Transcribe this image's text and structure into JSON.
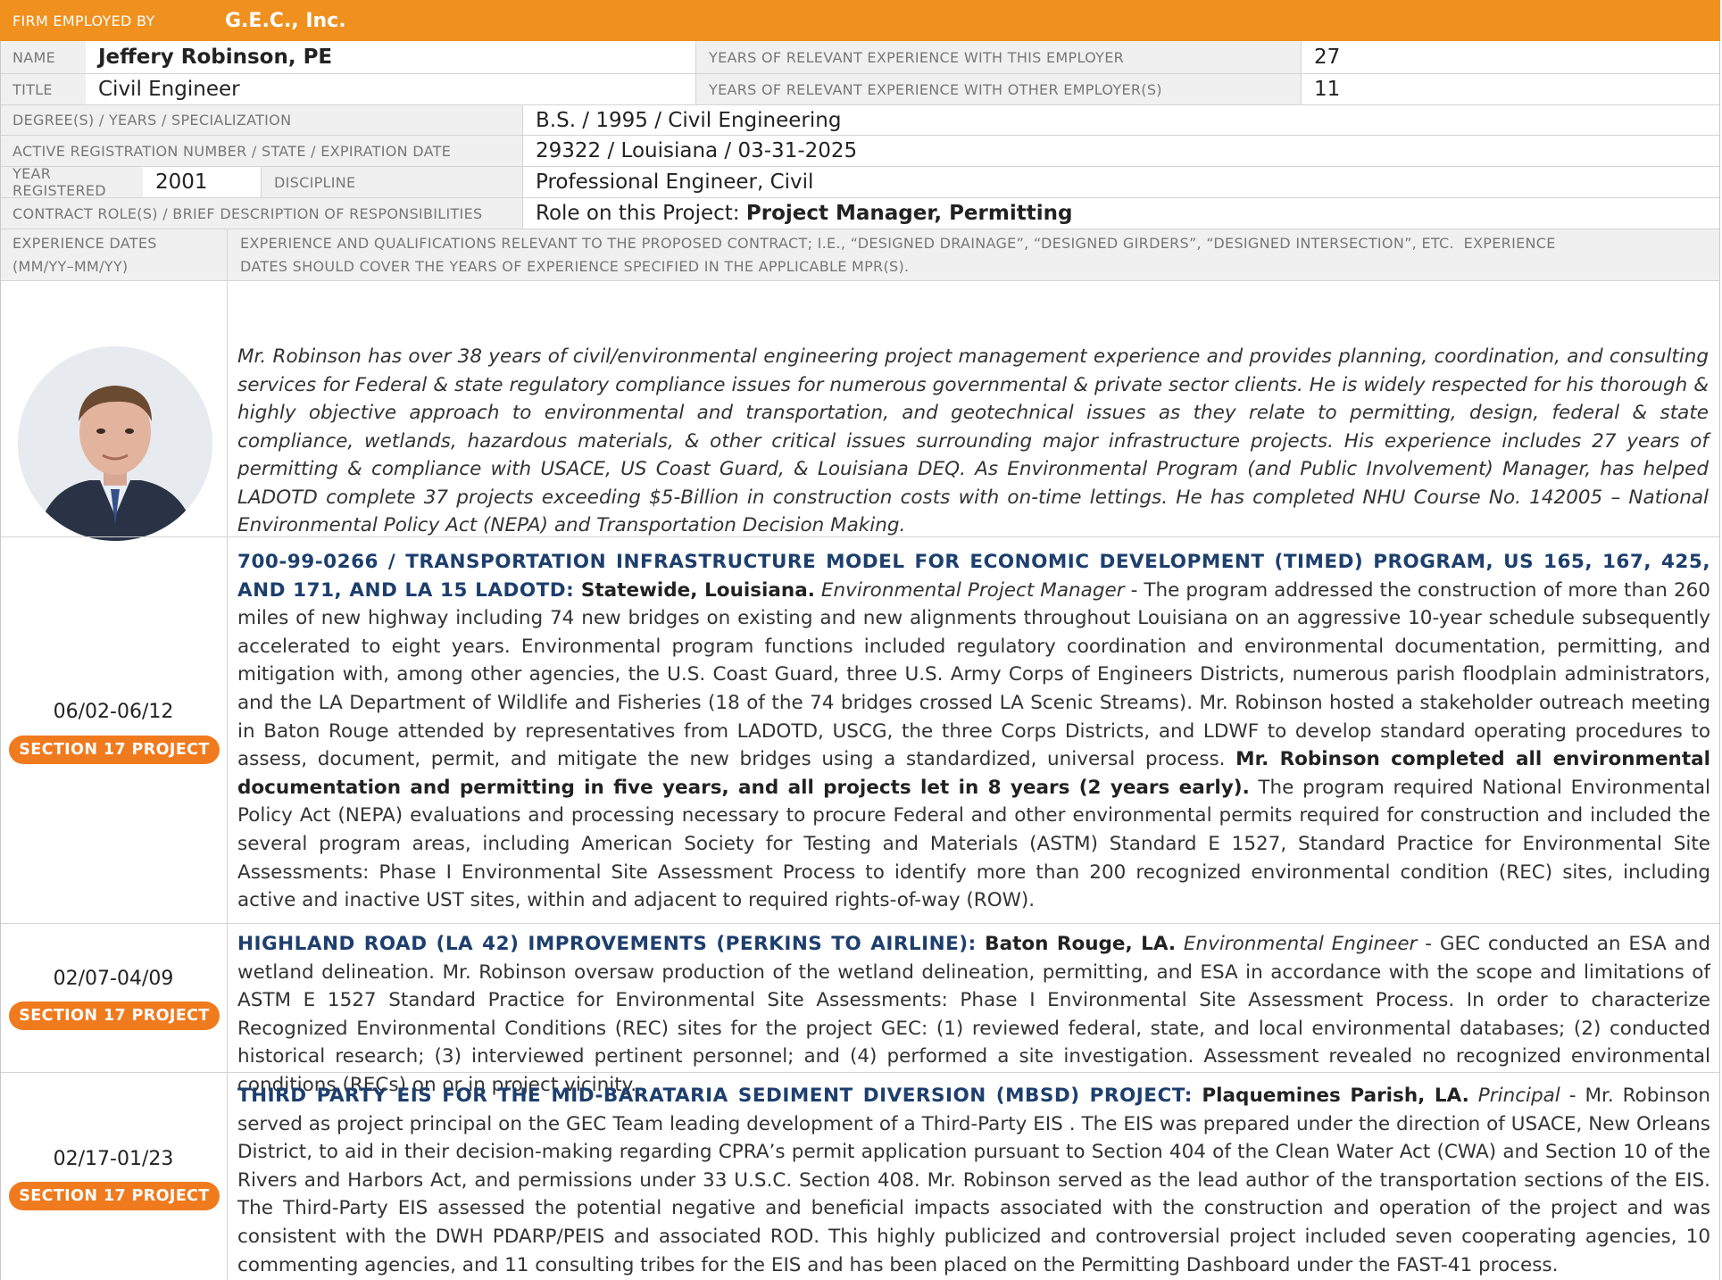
{
  "firm": {
    "label": "FIRM EMPLOYED BY",
    "name": "G.E.C., Inc."
  },
  "person": {
    "name_label": "NAME",
    "name": "Jeffery Robinson, PE",
    "title_label": "TITLE",
    "title": "Civil Engineer",
    "years_employer_label": "YEARS OF RELEVANT EXPERIENCE WITH THIS EMPLOYER",
    "years_employer": "27",
    "years_other_label": "YEARS OF RELEVANT EXPERIENCE WITH OTHER EMPLOYER(S)",
    "years_other": "11",
    "degree_label": "DEGREE(S) / YEARS / SPECIALIZATION",
    "degree": "B.S. / 1995 / Civil Engineering",
    "registration_label": "ACTIVE REGISTRATION NUMBER / STATE / EXPIRATION DATE",
    "registration": "29322 / Louisiana / 03-31-2025",
    "year_registered_label": "YEAR REGISTERED",
    "year_registered": "2001",
    "discipline_label": "DISCIPLINE",
    "discipline": "Professional Engineer, Civil",
    "contract_role_label": "CONTRACT ROLE(S) / BRIEF DESCRIPTION OF RESPONSIBILITIES",
    "role_prefix": "Role on this Project: ",
    "role": "Project Manager, Permitting"
  },
  "experience_header": {
    "dates_label_1": "EXPERIENCE DATES",
    "dates_label_2": "(MM/YY–MM/YY)",
    "qual_label_1": "EXPERIENCE AND QUALIFICATIONS RELEVANT TO THE PROPOSED CONTRACT; I.E., “DESIGNED DRAINAGE”, “DESIGNED GIRDERS”, “DESIGNED INTERSECTION”, ETC.  EXPERIENCE",
    "qual_label_2": "DATES SHOULD COVER THE YEARS OF EXPERIENCE SPECIFIED IN THE APPLICABLE MPR(S)."
  },
  "bio": "Mr. Robinson has over 38 years of civil/environmental engineering project management experience and provides planning, coordination, and consulting services for Federal & state regulatory compliance issues for numerous governmental & private sector clients. He is widely respected for his thorough & highly objective approach to environmental and transportation, and geotechnical issues as they relate to permitting, design, federal & state compliance, wetlands, hazardous materials, & other critical issues surrounding major infrastructure projects. His experience includes 27 years of permitting & compliance with USACE, US Coast Guard, & Louisiana DEQ. As Environmental Program (and Public Involvement) Manager, has helped LADOTD complete 37 projects exceeding $5-Billion in construction costs with on-time lettings. He has completed NHU Course No. 142005 – National Environmental Policy Act (NEPA) and Transportation Decision Making.",
  "badge_label": "SECTION 17 PROJECT",
  "projects": [
    {
      "dates": "06/02-06/12",
      "title": "700-99-0266 / TRANSPORTATION INFRASTRUCTURE MODEL FOR ECONOMIC DEVELOPMENT (TIMED) PROGRAM, US 165, 167, 425, AND 171, AND LA 15 LADOTD:",
      "location": " Statewide, Louisiana.",
      "role": " Environmental Project Manager",
      "desc_1": " - The program addressed the construction of more than 260 miles of new highway including 74 new bridges on existing and new alignments throughout Louisiana on an aggressive 10-year schedule subsequently accelerated to eight years. Environmental program functions included regulatory coordination and environmental documentation, permitting, and mitigation with, among other agencies, the U.S. Coast Guard, three U.S. Army Corps of Engineers Districts, numerous parish floodplain administrators, and the LA Department of Wildlife and Fisheries (18 of the 74 bridges crossed LA Scenic Streams). Mr. Robinson hosted a stakeholder outreach meeting in Baton Rouge attended by representatives from LADOTD, USCG, the three Corps Districts, and LDWF to develop standard operating procedures to assess, document, permit, and mitigate the new bridges using a standardized, universal process. ",
      "highlight": "Mr. Robinson completed all environmental documentation and permitting in five years, and all projects let in 8 years (2 years early).",
      "desc_2": " The program required National Environmental Policy Act (NEPA) evaluations and processing necessary to procure Federal and other environmental permits required for construction and included the several program areas, including American Society for Testing and Materials (ASTM) Standard E 1527, Standard Practice for Environmental Site Assessments:  Phase I Environmental Site Assessment Process to identify more than 200 recognized environmental condition (REC) sites, including active and inactive UST sites, within and adjacent to required rights-of-way (ROW)."
    },
    {
      "dates": "02/07-04/09",
      "title": "HIGHLAND ROAD (LA 42) IMPROVEMENTS (PERKINS TO AIRLINE):",
      "location": " Baton Rouge, LA.",
      "role": " Environmental Engineer",
      "desc_1": " - GEC conducted an ESA and wetland delineation. Mr. Robinson oversaw production of the wetland delineation, permitting, and ESA in accordance with the scope and limitations of ASTM E 1527 Standard Practice for Environmental Site Assessments: Phase I Environmental Site Assessment Process. In order to characterize Recognized Environmental Conditions (REC) sites for the project GEC: (1) reviewed federal, state, and local environmental databases; (2) conducted historical research; (3) interviewed pertinent personnel; and (4) performed a site investigation. Assessment revealed no recognized environmental conditions (RECs) on or in project vicinity.",
      "highlight": "",
      "desc_2": ""
    },
    {
      "dates": "02/17-01/23",
      "title": "THIRD PARTY EIS FOR THE MID-BARATARIA SEDIMENT DIVERSION (MBSD) PROJECT:",
      "location": " Plaquemines Parish, LA.",
      "role": " Principal",
      "desc_1": " - Mr. Robinson served as project principal on the GEC Team leading development of a Third-Party EIS .  The EIS was prepared under the direction of USACE, New Orleans District, to aid in their decision-making regarding CPRA’s permit application pursuant to Section 404 of the Clean Water Act (CWA) and Section 10 of the Rivers and Harbors Act, and permissions under 33 U.S.C. Section 408.  Mr. Robinson served as the lead author of the transportation sections of the EIS.  The Third-Party EIS assessed the potential negative and beneficial impacts associated with the construction and operation of the project and was consistent with the DWH PDARP/PEIS and associated ROD.  This highly publicized and controversial project included seven cooperating agencies, 10 commenting agencies, and 11 consulting tribes for the EIS and has been placed on the Permitting Dashboard under the FAST-41 process.",
      "highlight": "",
      "desc_2": ""
    }
  ],
  "colors": {
    "firm_bar": "#f0901e",
    "badge": "#f07a1e",
    "title_blue": "#1d3f6e",
    "label_grey": "#777777"
  },
  "icons": {
    "portrait": "person-portrait"
  }
}
